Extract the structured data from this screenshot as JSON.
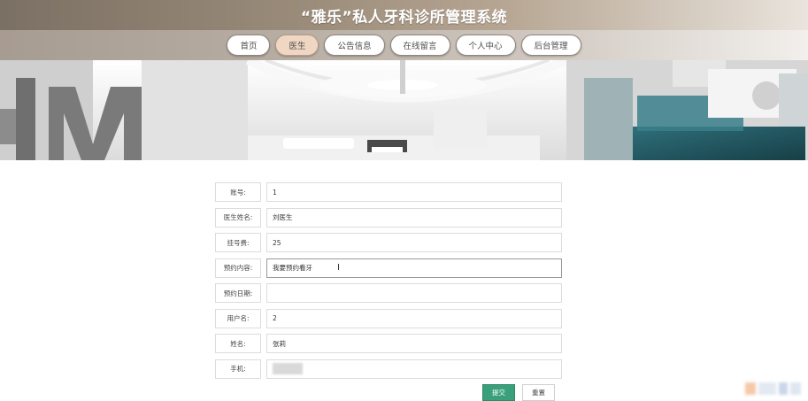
{
  "header": {
    "title": "“雅乐”私人牙科诊所管理系统"
  },
  "nav": {
    "items": [
      {
        "label": "首页",
        "active": false
      },
      {
        "label": "医生",
        "active": true
      },
      {
        "label": "公告信息",
        "active": false
      },
      {
        "label": "在线留言",
        "active": false
      },
      {
        "label": "个人中心",
        "active": false
      },
      {
        "label": "后台管理",
        "active": false
      }
    ]
  },
  "banner": {
    "icon": "dental-clinic-photo"
  },
  "form": {
    "account": {
      "label": "账号:",
      "value": "1"
    },
    "doctor_name": {
      "label": "医生姓名:",
      "value": "刘医生"
    },
    "fee": {
      "label": "挂号费:",
      "value": "25"
    },
    "content": {
      "label": "预约内容:",
      "value": "我要预约看牙"
    },
    "date": {
      "label": "预约日期:",
      "value": ""
    },
    "username": {
      "label": "用户名:",
      "value": "2"
    },
    "name": {
      "label": "姓名:",
      "value": "张莉"
    },
    "phone": {
      "label": "手机:",
      "value": ""
    }
  },
  "actions": {
    "submit_label": "提交",
    "reset_label": "重置"
  },
  "colors": {
    "submit": "#3aa07a",
    "nav_active": "#f0d7c4"
  }
}
